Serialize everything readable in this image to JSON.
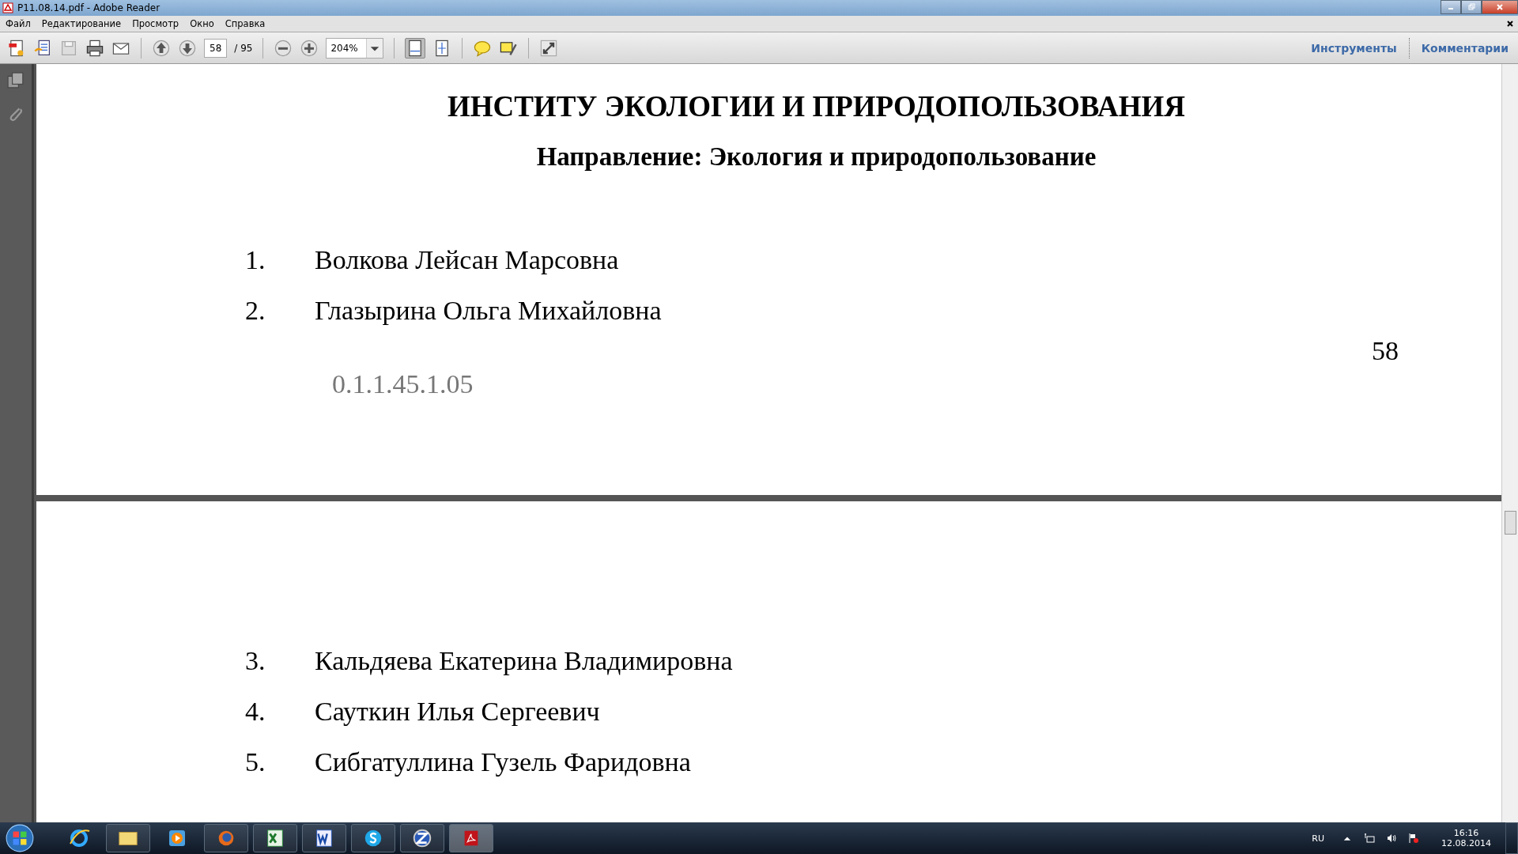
{
  "window": {
    "title": "P11.08.14.pdf - Adobe Reader"
  },
  "menu": [
    "Файл",
    "Редактирование",
    "Просмотр",
    "Окно",
    "Справка"
  ],
  "toolbar": {
    "page": "58",
    "page_total": "/ 95",
    "zoom": "204%",
    "panels": [
      "Инструменты",
      "Комментарии"
    ]
  },
  "pages": [
    {
      "headings": [
        "ИНСТИТУ ЭКОЛОГИИ И ПРИРОДОПОЛЬЗОВАНИЯ",
        "Направление: Экология и природопользование"
      ],
      "items": [
        {
          "number": "1.",
          "name": "Волкова Лейсан Марсовна"
        },
        {
          "number": "2.",
          "name": "Глазырина Ольга Михайловна"
        }
      ],
      "page_number": "58",
      "code": "0.1.1.45.1.05"
    },
    {
      "items": [
        {
          "number": "3.",
          "name": "Кальдяева Екатерина Владимировна"
        },
        {
          "number": "4.",
          "name": "Сауткин Илья Сергеевич"
        },
        {
          "number": "5.",
          "name": "Сибгатуллина Гузель Фаридовна"
        }
      ]
    }
  ],
  "tray": {
    "language": "RU",
    "time": "16:16",
    "date": "12.08.2014"
  }
}
